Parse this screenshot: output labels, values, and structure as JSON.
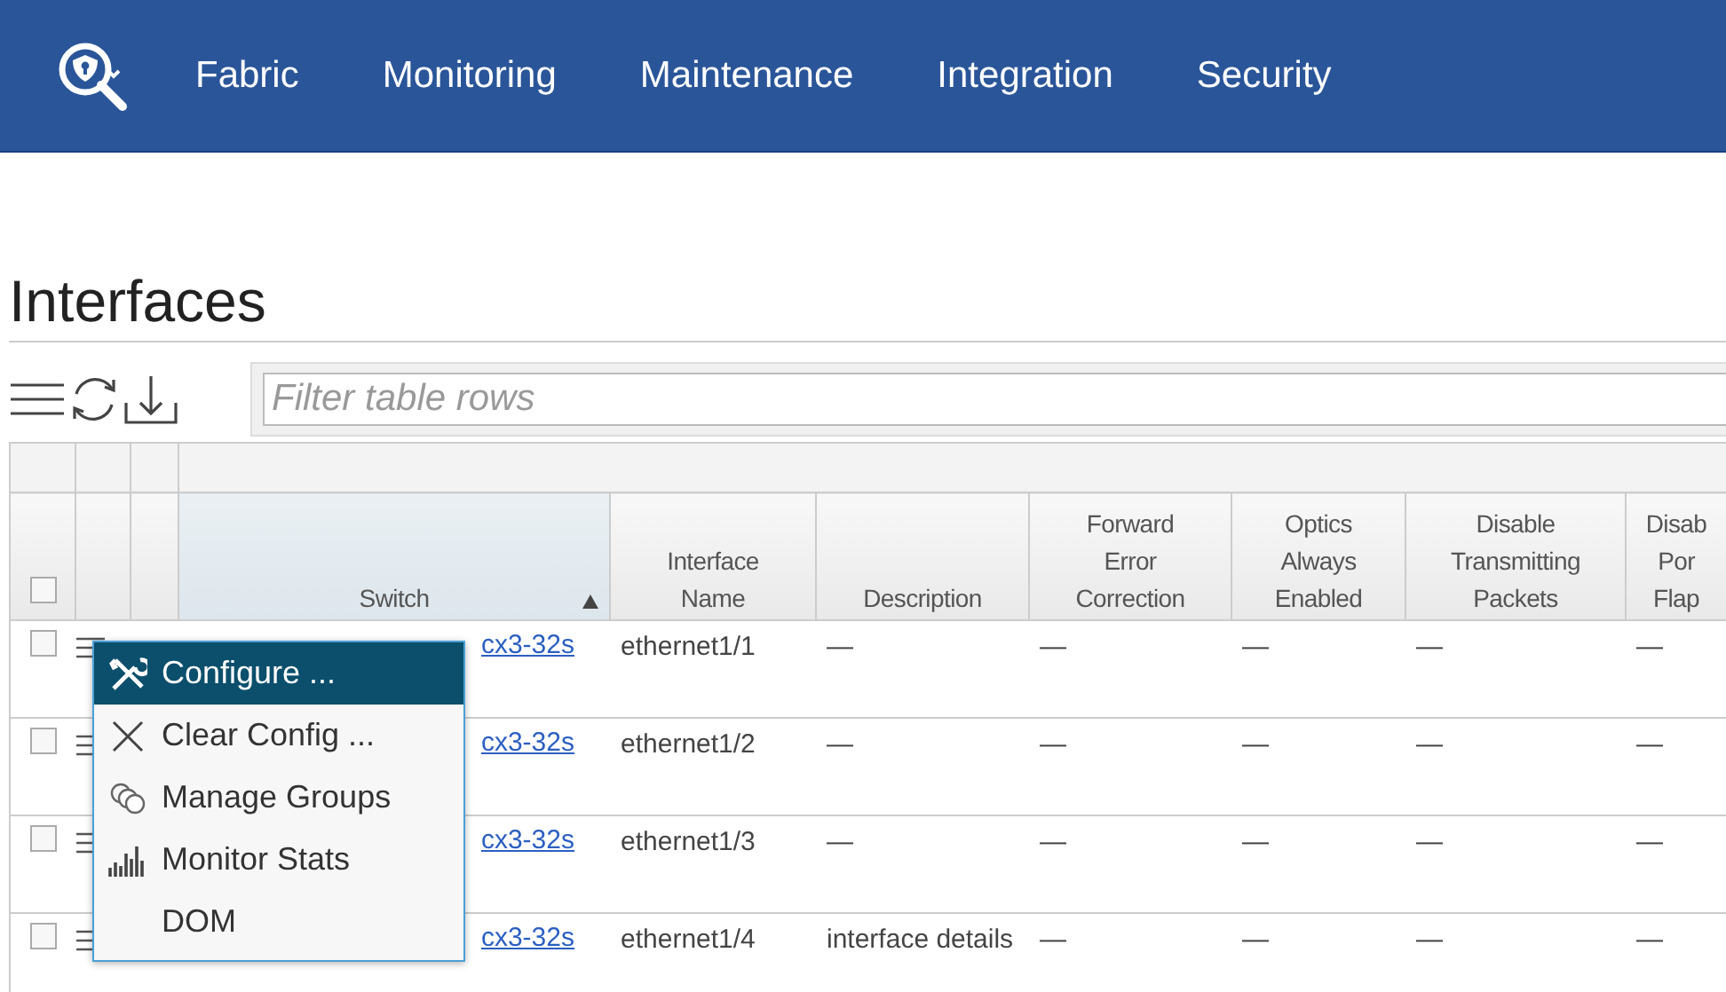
{
  "nav": {
    "items": [
      "Fabric",
      "Monitoring",
      "Maintenance",
      "Integration",
      "Security"
    ]
  },
  "page": {
    "title": "Interfaces"
  },
  "filter": {
    "placeholder": "Filter table rows"
  },
  "table": {
    "select_all": {
      "checked": false
    },
    "columns": [
      {
        "label": "Switch",
        "sorted": true
      },
      {
        "label": "Interface Name",
        "sorted": false
      },
      {
        "label": "Description",
        "sorted": false
      },
      {
        "label": "Forward Error Correction",
        "sorted": false
      },
      {
        "label": "Optics Always Enabled",
        "sorted": false
      },
      {
        "label": "Disable Transmitting Packets",
        "sorted": false
      },
      {
        "label": "Disab Por Flap",
        "sorted": false
      }
    ],
    "rows": [
      {
        "checked": false,
        "cells": [
          "cx3-32s",
          "ethernet1/1",
          "—",
          "—",
          "—",
          "—",
          "—"
        ]
      },
      {
        "checked": false,
        "cells": [
          "cx3-32s",
          "ethernet1/2",
          "—",
          "—",
          "—",
          "—",
          "—"
        ]
      },
      {
        "checked": false,
        "cells": [
          "cx3-32s",
          "ethernet1/3",
          "—",
          "—",
          "—",
          "—",
          "—"
        ]
      },
      {
        "checked": false,
        "cells": [
          "cx3-32s",
          "ethernet1/4",
          "interface details",
          "—",
          "—",
          "—",
          "—"
        ]
      }
    ]
  },
  "context_menu": {
    "items": [
      {
        "label": "Configure ...",
        "kind": "tools",
        "selected": true
      },
      {
        "label": "Clear Config ...",
        "kind": "clear",
        "selected": false
      },
      {
        "label": "Manage Groups",
        "kind": "groups",
        "selected": false
      },
      {
        "label": "Monitor Stats",
        "kind": "stats",
        "selected": false
      },
      {
        "label": "DOM",
        "kind": "none",
        "selected": false
      }
    ]
  }
}
